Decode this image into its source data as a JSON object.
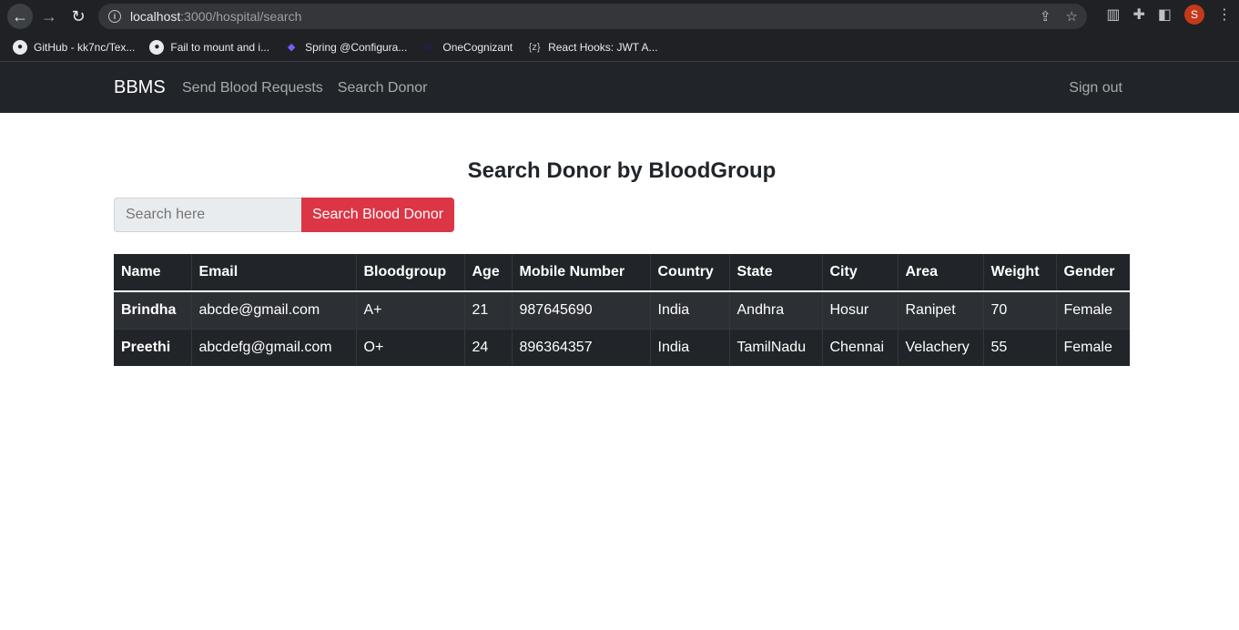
{
  "browser": {
    "url_host": "localhost",
    "url_path": ":3000/hospital/search",
    "profile_initial": "S",
    "bookmarks": [
      {
        "label": "GitHub - kk7nc/Tex...",
        "icon": "github-icon"
      },
      {
        "label": "Fail to mount and i...",
        "icon": "github-icon"
      },
      {
        "label": "Spring @Configura...",
        "icon": "spring-icon"
      },
      {
        "label": "OneCognizant",
        "icon": "cognizant-icon"
      },
      {
        "label": "React Hooks: JWT A...",
        "icon": "braces-icon"
      }
    ]
  },
  "navbar": {
    "brand": "BBMS",
    "links": [
      "Send Blood Requests",
      "Search Donor"
    ],
    "signout": "Sign out"
  },
  "page": {
    "title": "Search Donor by BloodGroup",
    "search_placeholder": "Search here",
    "search_button": "Search Blood Donor"
  },
  "table": {
    "headers": [
      "Name",
      "Email",
      "Bloodgroup",
      "Age",
      "Mobile Number",
      "Country",
      "State",
      "City",
      "Area",
      "Weight",
      "Gender"
    ],
    "rows": [
      [
        "Brindha",
        "abcde@gmail.com",
        "A+",
        "21",
        "987645690",
        "India",
        "Andhra",
        "Hosur",
        "Ranipet",
        "70",
        "Female"
      ],
      [
        "Preethi",
        "abcdefg@gmail.com",
        "O+",
        "24",
        "896364357",
        "India",
        "TamilNadu",
        "Chennai",
        "Velachery",
        "55",
        "Female"
      ]
    ]
  },
  "colors": {
    "navbar_bg": "#212529",
    "button_danger": "#dc3545"
  }
}
